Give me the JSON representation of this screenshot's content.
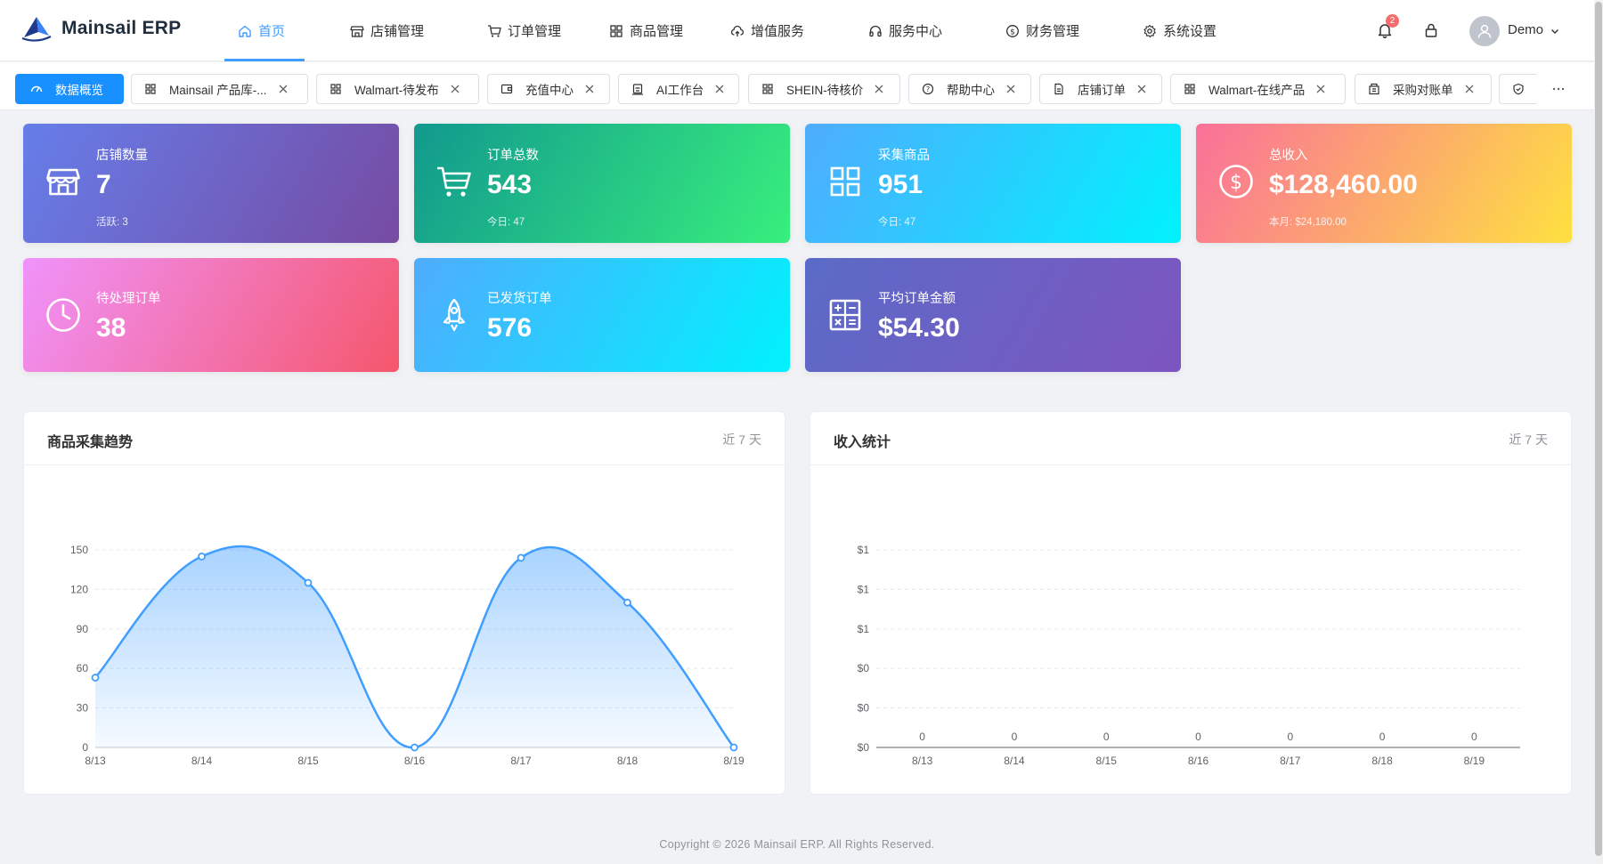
{
  "app": {
    "title": "Mainsail ERP"
  },
  "nav": [
    {
      "label": "首页",
      "icon": "home-icon",
      "active": true
    },
    {
      "label": "店铺管理",
      "icon": "store-icon"
    },
    {
      "label": "订单管理",
      "icon": "cart-icon"
    },
    {
      "label": "商品管理",
      "icon": "grid-icon"
    },
    {
      "label": "增值服务",
      "icon": "cloud-upload-icon"
    },
    {
      "label": "服务中心",
      "icon": "headset-icon"
    },
    {
      "label": "财务管理",
      "icon": "dollar-circle-icon"
    },
    {
      "label": "系统设置",
      "icon": "gear-icon"
    }
  ],
  "header": {
    "notification_count": "2",
    "user_name": "Demo"
  },
  "tabs": [
    {
      "label": "数据概览",
      "icon": "dashboard-icon",
      "active": true
    },
    {
      "label": "Mainsail 产品库-...",
      "icon": "grid-icon"
    },
    {
      "label": "Walmart-待发布",
      "icon": "grid-icon"
    },
    {
      "label": "充值中心",
      "icon": "wallet-icon"
    },
    {
      "label": "AI工作台",
      "icon": "robot-icon"
    },
    {
      "label": "SHEIN-待核价",
      "icon": "grid-icon"
    },
    {
      "label": "帮助中心",
      "icon": "question-circle-icon"
    },
    {
      "label": "店铺订单",
      "icon": "document-icon"
    },
    {
      "label": "Walmart-在线产品",
      "icon": "grid-icon"
    },
    {
      "label": "采购对账单",
      "icon": "building-icon"
    }
  ],
  "stats": [
    {
      "label": "店铺数量",
      "value": "7",
      "sub": "活跃: 3",
      "icon": "store-icon",
      "gradient": [
        "#667eea",
        "#764ba2"
      ]
    },
    {
      "label": "订单总数",
      "value": "543",
      "sub": "今日: 47",
      "icon": "cart-icon",
      "gradient": [
        "#11998e",
        "#38ef7d"
      ]
    },
    {
      "label": "采集商品",
      "value": "951",
      "sub": "今日: 47",
      "icon": "grid-icon",
      "gradient": [
        "#4facfe",
        "#00f2fe"
      ]
    },
    {
      "label": "总收入",
      "value": "$128,460.00",
      "sub": "本月: $24,180.00",
      "icon": "dollar-circle-icon",
      "gradient": [
        "#fa709a",
        "#fee140"
      ]
    },
    {
      "label": "待处理订单",
      "value": "38",
      "icon": "clock-icon",
      "gradient": [
        "#f093fb",
        "#f5576c"
      ]
    },
    {
      "label": "已发货订单",
      "value": "576",
      "icon": "rocket-icon",
      "gradient": [
        "#4facfe",
        "#00f2fe"
      ]
    },
    {
      "label": "平均订单金额",
      "value": "$54.30",
      "icon": "calculator-icon",
      "gradient": [
        "#5b6bc7",
        "#7d55c0"
      ]
    }
  ],
  "panels": [
    {
      "title": "商品采集趋势",
      "range": "近 7 天"
    },
    {
      "title": "收入统计",
      "range": "近 7 天"
    }
  ],
  "chart_data": [
    {
      "type": "area",
      "title": "商品采集趋势",
      "categories": [
        "8/13",
        "8/14",
        "8/15",
        "8/16",
        "8/17",
        "8/18",
        "8/19"
      ],
      "values": [
        53,
        145,
        125,
        0,
        144,
        110,
        0
      ],
      "ylim": [
        0,
        150
      ],
      "yticks": [
        "0",
        "30",
        "60",
        "90",
        "120",
        "150"
      ],
      "grid": true,
      "color": "#409eff"
    },
    {
      "type": "bar",
      "title": "收入统计",
      "categories": [
        "8/13",
        "8/14",
        "8/15",
        "8/16",
        "8/17",
        "8/18",
        "8/19"
      ],
      "values": [
        0,
        0,
        0,
        0,
        0,
        0,
        0
      ],
      "data_labels": [
        "0",
        "0",
        "0",
        "0",
        "0",
        "0",
        "0"
      ],
      "yticks": [
        "$0",
        "$0",
        "$0",
        "$1",
        "$1",
        "$1"
      ],
      "grid": true
    }
  ],
  "footer": {
    "text": "Copyright © 2026 Mainsail ERP. All Rights Reserved."
  }
}
